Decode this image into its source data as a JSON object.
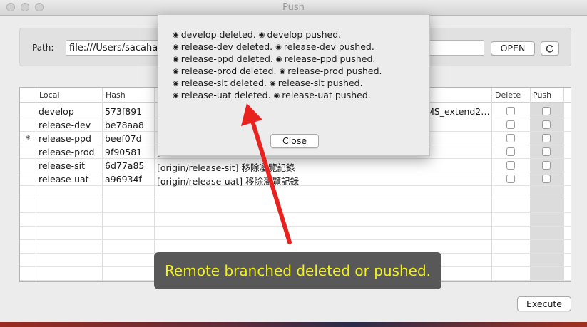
{
  "window": {
    "title": "Push"
  },
  "path": {
    "label": "Path:",
    "value": "file:///Users/sacahan/",
    "open_label": "OPEN",
    "refresh_icon": "refresh-icon"
  },
  "table": {
    "columns": {
      "local": "Local",
      "hash": "Hash",
      "delete": "Delete",
      "push": "Push"
    },
    "rows": [
      {
        "marker": "",
        "local": "develop",
        "hash": "573f891",
        "message": "[",
        "message_tail": "MS_extend2…"
      },
      {
        "marker": "",
        "local": "release-dev",
        "hash": "be78aa8",
        "message": "[",
        "message_tail": ""
      },
      {
        "marker": "*",
        "local": "release-ppd",
        "hash": "beef07d",
        "message": "[",
        "message_tail": ""
      },
      {
        "marker": "",
        "local": "release-prod",
        "hash": "9f90581",
        "message": "[",
        "message_tail": ""
      },
      {
        "marker": "",
        "local": "release-sit",
        "hash": "6d77a85",
        "message": "[origin/release-sit] 移除瀏覽記錄",
        "message_tail": ""
      },
      {
        "marker": "",
        "local": "release-uat",
        "hash": "a96934f",
        "message": "[origin/release-uat] 移除瀏覽記錄",
        "message_tail": ""
      }
    ]
  },
  "execute_label": "Execute",
  "popup": {
    "messages": [
      [
        "develop deleted.",
        "develop pushed."
      ],
      [
        "release-dev deleted.",
        "release-dev pushed."
      ],
      [
        "release-ppd deleted.",
        "release-ppd pushed."
      ],
      [
        "release-prod deleted.",
        "release-prod pushed."
      ],
      [
        "release-sit deleted.",
        "release-sit pushed."
      ],
      [
        "release-uat deleted.",
        "release-uat pushed."
      ]
    ],
    "bullet": "◉",
    "close_label": "Close"
  },
  "annotation": {
    "text": "Remote branched deleted or pushed.",
    "color": "#f2f218",
    "arrow_color": "#e8221f"
  }
}
